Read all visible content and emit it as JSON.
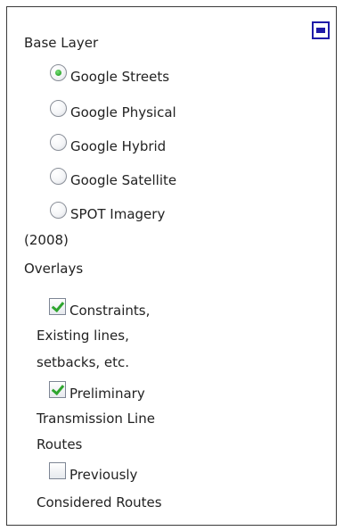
{
  "headings": {
    "base_layer": "Base Layer",
    "overlays": "Overlays"
  },
  "base_layers": [
    {
      "label": "Google Streets",
      "selected": true
    },
    {
      "label": "Google Physical",
      "selected": false
    },
    {
      "label": "Google Hybrid",
      "selected": false
    },
    {
      "label": "Google Satellite",
      "selected": false
    },
    {
      "label": "SPOT Imagery",
      "label_cont": "(2008)",
      "selected": false
    }
  ],
  "overlays": [
    {
      "lines": [
        "Constraints,",
        "Existing lines,",
        "setbacks, etc."
      ],
      "checked": true
    },
    {
      "lines": [
        "Preliminary",
        "Transmission Line",
        "Routes"
      ],
      "checked": true
    },
    {
      "lines": [
        "Previously",
        "Considered Routes"
      ],
      "checked": false
    }
  ],
  "colors": {
    "accent": "#1f1aa8",
    "check": "#2ea52e",
    "border": "#3a3a3a"
  },
  "icons": {
    "minimize": "minimize-icon"
  }
}
